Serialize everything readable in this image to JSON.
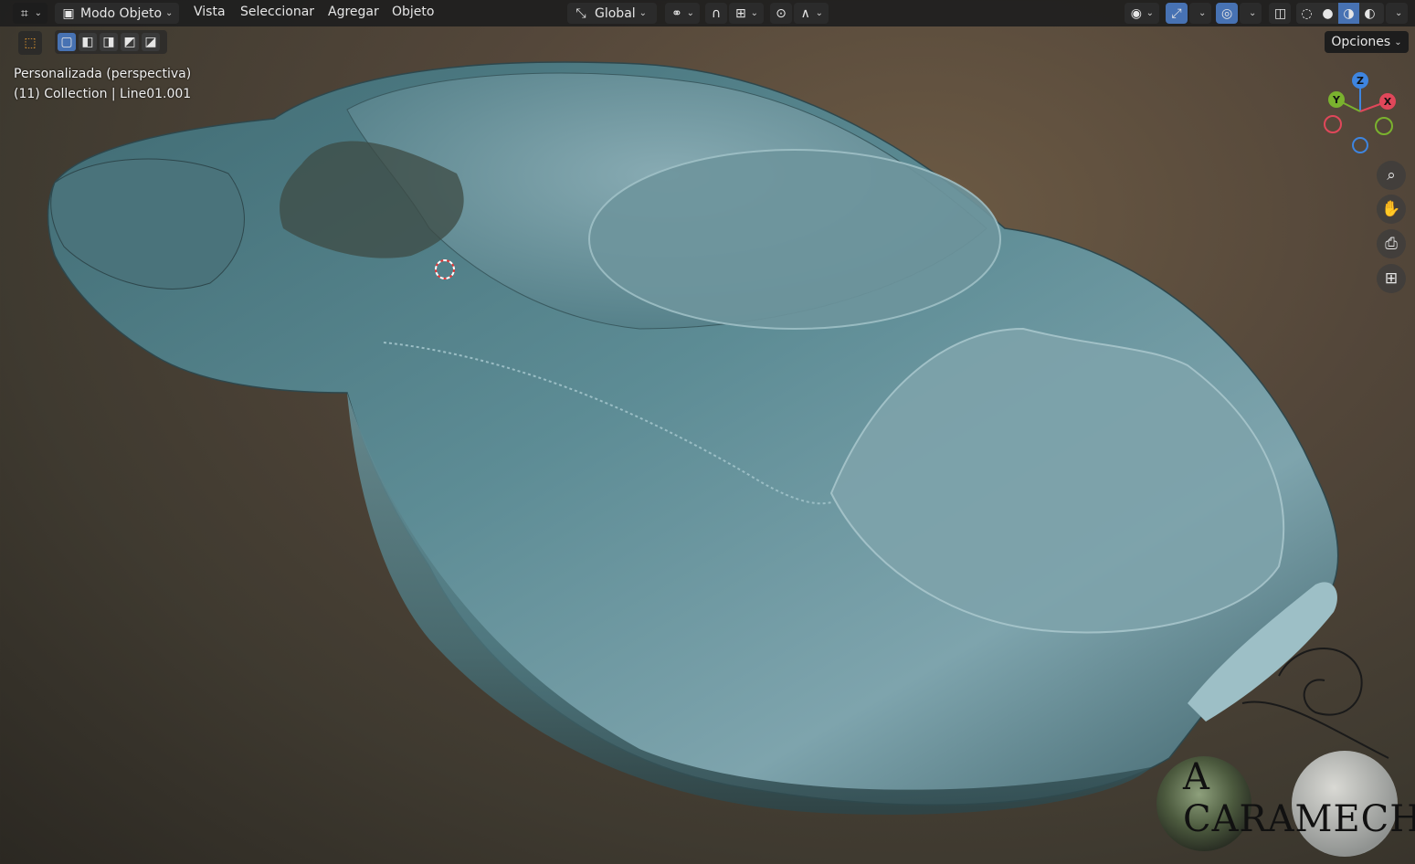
{
  "header": {
    "editor_type_icon": "viewport-grid-icon",
    "mode_label": "Modo Objeto",
    "menus": [
      "Vista",
      "Seleccionar",
      "Agregar",
      "Objeto"
    ],
    "transform_orientation": "Global",
    "options_label": "Opciones"
  },
  "viewport": {
    "view_name": "Personalizada (perspectiva)",
    "collection_info": "(11) Collection | Line01.001"
  },
  "gizmo": {
    "z": "Z",
    "y": "Y",
    "x": "X"
  },
  "watermark": {
    "text": "A CARAMECHA"
  },
  "colors": {
    "header_bg": "#1e1e1e",
    "accent": "#4772b3",
    "axis_x": "#e0475a",
    "axis_y": "#7ab22e",
    "axis_z": "#3e85e0",
    "car_body": "#4f7c84"
  }
}
